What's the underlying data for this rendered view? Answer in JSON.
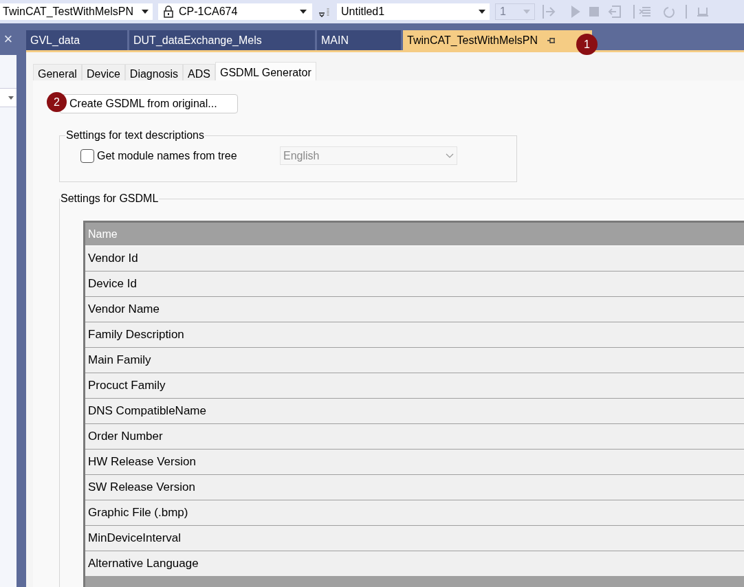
{
  "toolbar": {
    "project_combo": "TwinCAT_TestWithMelsPN",
    "target_combo": "CP-1CA674",
    "config_combo": "Untitled1",
    "number_combo": {
      "value": "1",
      "disabled": true
    }
  },
  "left_panel": {
    "close": "×"
  },
  "document_tabs": [
    {
      "label": "GVL_data",
      "selected": false
    },
    {
      "label": "DUT_dataExchange_Mels",
      "selected": false
    },
    {
      "label": "MAIN",
      "selected": false
    },
    {
      "label": "TwinCAT_TestWithMelsPN",
      "selected": true
    }
  ],
  "badges": [
    "1",
    "2"
  ],
  "inner_tabs": [
    {
      "label": "General",
      "selected": false
    },
    {
      "label": "Device",
      "selected": false
    },
    {
      "label": "Diagnosis",
      "selected": false
    },
    {
      "label": "ADS",
      "selected": false
    },
    {
      "label": "GSDML Generator",
      "selected": true
    }
  ],
  "create_button": "Create GSDML from original...",
  "text_settings": {
    "title": "Settings for text descriptions",
    "checkbox": {
      "label": "Get module names from tree",
      "checked": false
    },
    "language": {
      "value": "English",
      "disabled": true
    }
  },
  "gsdml_settings": {
    "title": "Settings for GSDML",
    "table": {
      "columns": [
        "Name"
      ],
      "rows": [
        "Vendor Id",
        "Device Id",
        "Vendor Name",
        "Family Description",
        "Main Family",
        "Procuct Family",
        "DNS CompatibleName",
        "Order Number",
        "HW Release Version",
        "SW Release Version",
        "Graphic File (.bmp)",
        "MinDeviceInterval",
        "Alternative Language"
      ]
    }
  }
}
